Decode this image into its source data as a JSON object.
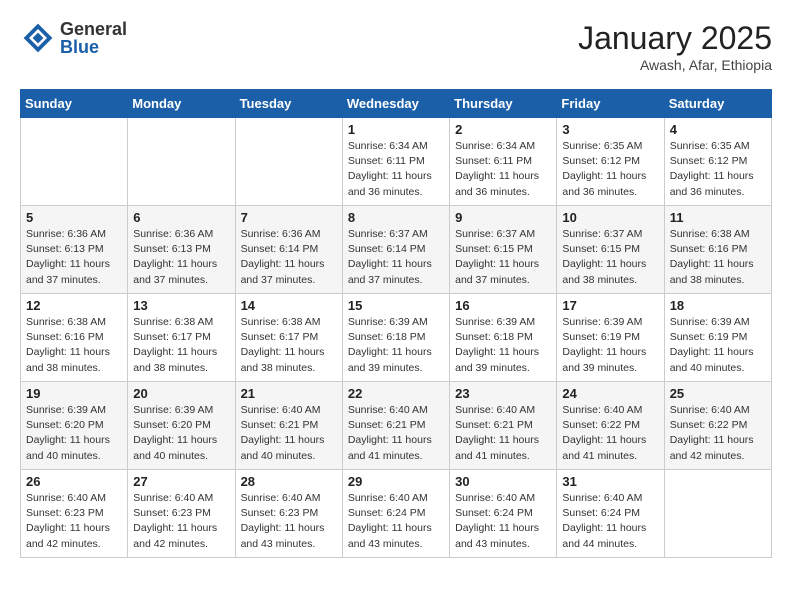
{
  "header": {
    "logo_general": "General",
    "logo_blue": "Blue",
    "month_title": "January 2025",
    "location": "Awash, Afar, Ethiopia"
  },
  "weekdays": [
    "Sunday",
    "Monday",
    "Tuesday",
    "Wednesday",
    "Thursday",
    "Friday",
    "Saturday"
  ],
  "weeks": [
    [
      {
        "day": "",
        "info": ""
      },
      {
        "day": "",
        "info": ""
      },
      {
        "day": "",
        "info": ""
      },
      {
        "day": "1",
        "info": "Sunrise: 6:34 AM\nSunset: 6:11 PM\nDaylight: 11 hours\nand 36 minutes."
      },
      {
        "day": "2",
        "info": "Sunrise: 6:34 AM\nSunset: 6:11 PM\nDaylight: 11 hours\nand 36 minutes."
      },
      {
        "day": "3",
        "info": "Sunrise: 6:35 AM\nSunset: 6:12 PM\nDaylight: 11 hours\nand 36 minutes."
      },
      {
        "day": "4",
        "info": "Sunrise: 6:35 AM\nSunset: 6:12 PM\nDaylight: 11 hours\nand 36 minutes."
      }
    ],
    [
      {
        "day": "5",
        "info": "Sunrise: 6:36 AM\nSunset: 6:13 PM\nDaylight: 11 hours\nand 37 minutes."
      },
      {
        "day": "6",
        "info": "Sunrise: 6:36 AM\nSunset: 6:13 PM\nDaylight: 11 hours\nand 37 minutes."
      },
      {
        "day": "7",
        "info": "Sunrise: 6:36 AM\nSunset: 6:14 PM\nDaylight: 11 hours\nand 37 minutes."
      },
      {
        "day": "8",
        "info": "Sunrise: 6:37 AM\nSunset: 6:14 PM\nDaylight: 11 hours\nand 37 minutes."
      },
      {
        "day": "9",
        "info": "Sunrise: 6:37 AM\nSunset: 6:15 PM\nDaylight: 11 hours\nand 37 minutes."
      },
      {
        "day": "10",
        "info": "Sunrise: 6:37 AM\nSunset: 6:15 PM\nDaylight: 11 hours\nand 38 minutes."
      },
      {
        "day": "11",
        "info": "Sunrise: 6:38 AM\nSunset: 6:16 PM\nDaylight: 11 hours\nand 38 minutes."
      }
    ],
    [
      {
        "day": "12",
        "info": "Sunrise: 6:38 AM\nSunset: 6:16 PM\nDaylight: 11 hours\nand 38 minutes."
      },
      {
        "day": "13",
        "info": "Sunrise: 6:38 AM\nSunset: 6:17 PM\nDaylight: 11 hours\nand 38 minutes."
      },
      {
        "day": "14",
        "info": "Sunrise: 6:38 AM\nSunset: 6:17 PM\nDaylight: 11 hours\nand 38 minutes."
      },
      {
        "day": "15",
        "info": "Sunrise: 6:39 AM\nSunset: 6:18 PM\nDaylight: 11 hours\nand 39 minutes."
      },
      {
        "day": "16",
        "info": "Sunrise: 6:39 AM\nSunset: 6:18 PM\nDaylight: 11 hours\nand 39 minutes."
      },
      {
        "day": "17",
        "info": "Sunrise: 6:39 AM\nSunset: 6:19 PM\nDaylight: 11 hours\nand 39 minutes."
      },
      {
        "day": "18",
        "info": "Sunrise: 6:39 AM\nSunset: 6:19 PM\nDaylight: 11 hours\nand 40 minutes."
      }
    ],
    [
      {
        "day": "19",
        "info": "Sunrise: 6:39 AM\nSunset: 6:20 PM\nDaylight: 11 hours\nand 40 minutes."
      },
      {
        "day": "20",
        "info": "Sunrise: 6:39 AM\nSunset: 6:20 PM\nDaylight: 11 hours\nand 40 minutes."
      },
      {
        "day": "21",
        "info": "Sunrise: 6:40 AM\nSunset: 6:21 PM\nDaylight: 11 hours\nand 40 minutes."
      },
      {
        "day": "22",
        "info": "Sunrise: 6:40 AM\nSunset: 6:21 PM\nDaylight: 11 hours\nand 41 minutes."
      },
      {
        "day": "23",
        "info": "Sunrise: 6:40 AM\nSunset: 6:21 PM\nDaylight: 11 hours\nand 41 minutes."
      },
      {
        "day": "24",
        "info": "Sunrise: 6:40 AM\nSunset: 6:22 PM\nDaylight: 11 hours\nand 41 minutes."
      },
      {
        "day": "25",
        "info": "Sunrise: 6:40 AM\nSunset: 6:22 PM\nDaylight: 11 hours\nand 42 minutes."
      }
    ],
    [
      {
        "day": "26",
        "info": "Sunrise: 6:40 AM\nSunset: 6:23 PM\nDaylight: 11 hours\nand 42 minutes."
      },
      {
        "day": "27",
        "info": "Sunrise: 6:40 AM\nSunset: 6:23 PM\nDaylight: 11 hours\nand 42 minutes."
      },
      {
        "day": "28",
        "info": "Sunrise: 6:40 AM\nSunset: 6:23 PM\nDaylight: 11 hours\nand 43 minutes."
      },
      {
        "day": "29",
        "info": "Sunrise: 6:40 AM\nSunset: 6:24 PM\nDaylight: 11 hours\nand 43 minutes."
      },
      {
        "day": "30",
        "info": "Sunrise: 6:40 AM\nSunset: 6:24 PM\nDaylight: 11 hours\nand 43 minutes."
      },
      {
        "day": "31",
        "info": "Sunrise: 6:40 AM\nSunset: 6:24 PM\nDaylight: 11 hours\nand 44 minutes."
      },
      {
        "day": "",
        "info": ""
      }
    ]
  ]
}
